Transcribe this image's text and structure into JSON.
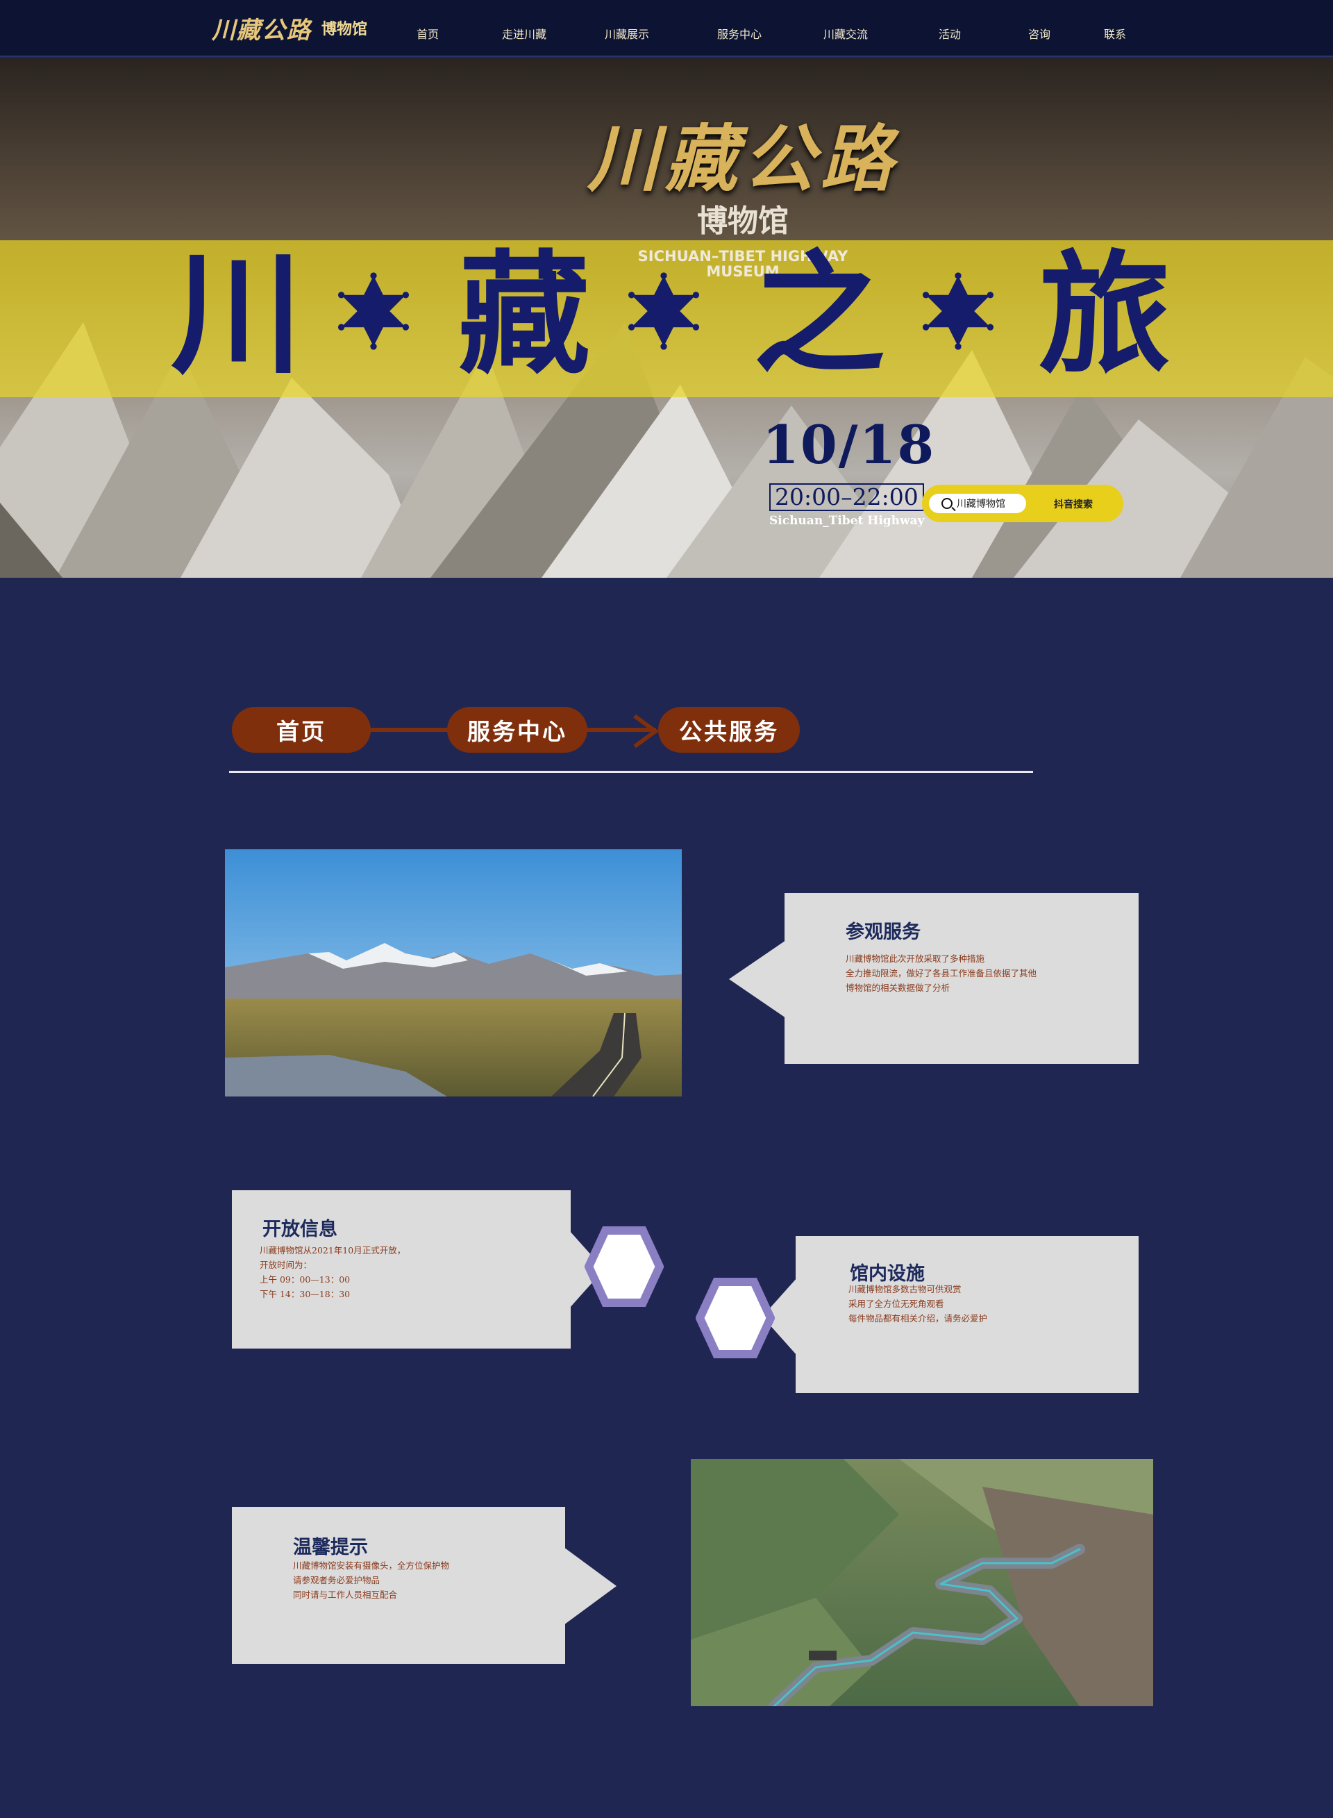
{
  "nav": {
    "logo_script": "川藏公路",
    "logo_sub": "博物馆",
    "items": [
      "首页",
      "走进川藏",
      "川藏展示",
      "服务中心",
      "川藏交流",
      "活动",
      "咨询",
      "联系"
    ]
  },
  "hero": {
    "title_script": "川藏公路",
    "title_sub": "博物馆",
    "title_en_line1": "SICHUAN–TIBET HIGHWAY",
    "title_en_line2": "MUSEUM",
    "big_chars": [
      "川",
      "藏",
      "之",
      "旅"
    ],
    "date": "10/18",
    "time": "20:00–22:00",
    "caption": "Sichuan_Tibet Highway",
    "search_placeholder": "川藏博物馆",
    "search_button": "抖音搜索"
  },
  "breadcrumb": {
    "items": [
      "首页",
      "服务中心",
      "公共服务"
    ]
  },
  "cards": {
    "visit": {
      "title": "参观服务",
      "lines": [
        "川藏博物馆此次开放采取了多种措施",
        "全力推动限流，做好了各县工作准备且依据了其他",
        "博物馆的相关数据做了分析"
      ]
    },
    "open": {
      "title": "开放信息",
      "lines": [
        "川藏博物馆从2021年10月正式开放，",
        "开放时间为：",
        "上午 09：00—13：00",
        "下午 14：30—18：30"
      ]
    },
    "facility": {
      "title": "馆内设施",
      "lines": [
        "川藏博物馆多数古物可供观赏",
        "采用了全方位无死角观看",
        "每件物品都有相关介绍，请务必爱护"
      ]
    },
    "tips": {
      "title": "温馨提示",
      "lines": [
        "川藏博物馆安装有摄像头，全方位保护物",
        "请参观者务必爱护物品",
        "同时请与工作人员相互配合"
      ]
    }
  },
  "colors": {
    "page_bg": "#1f2652",
    "nav_bg": "#0d1433",
    "band_yellow": "#e8d426",
    "title_navy": "#141c6b",
    "crumb_brown": "#7f2f0c",
    "card_gray": "#dcdcdc",
    "hex_purple": "#8b7fc4",
    "body_text": "#8a3a1c"
  }
}
